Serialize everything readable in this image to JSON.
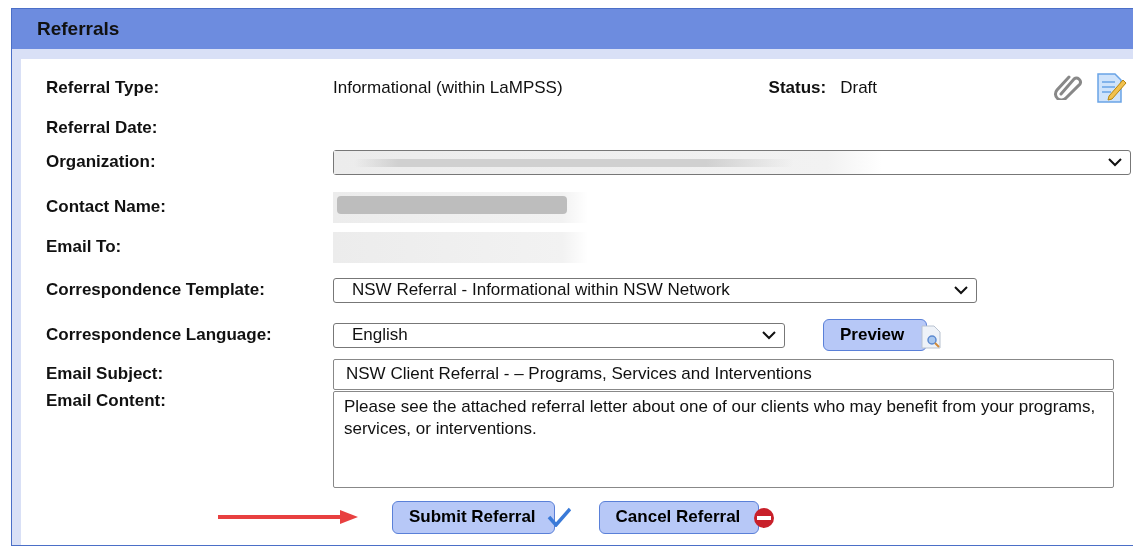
{
  "panel": {
    "title": "Referrals"
  },
  "referral_type": {
    "label": "Referral Type:",
    "value": "Informational (within LaMPSS)"
  },
  "status": {
    "label": "Status:",
    "value": "Draft"
  },
  "fields": [
    {
      "kind": "text",
      "label": "Referral Date:"
    },
    {
      "kind": "select",
      "label": "Organization:",
      "redacted": true
    },
    {
      "kind": "input",
      "label": "Contact Name:",
      "redacted": true
    },
    {
      "kind": "input",
      "label": "Email To:",
      "redacted": true
    },
    {
      "kind": "select",
      "label": "Correspondence Template:",
      "value": "NSW Referral - Informational within NSW Network"
    },
    {
      "kind": "select",
      "label": "Correspondence Language:",
      "value": "English",
      "button": "Preview"
    },
    {
      "kind": "input",
      "label": "Email Subject:",
      "value": "NSW Client Referral - – Programs, Services and Interventions"
    },
    {
      "kind": "textarea",
      "label": "Email Content:",
      "value": "Please see the attached referral letter about one of our clients who may benefit from your programs, services, or interventions."
    }
  ],
  "actions": [
    {
      "label": "Submit Referral",
      "kind": "submit"
    },
    {
      "label": "Cancel Referral",
      "kind": "cancel"
    }
  ]
}
